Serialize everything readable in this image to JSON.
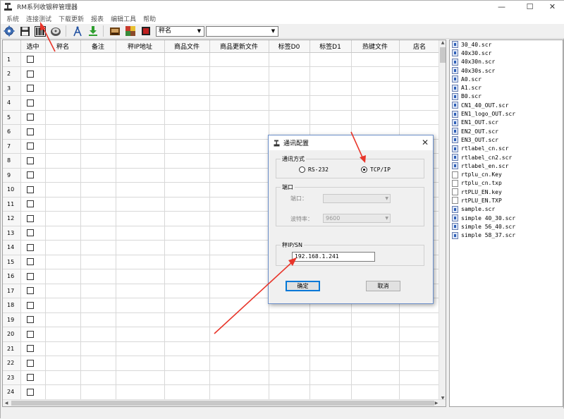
{
  "window": {
    "title": "RM系列收银秤管理器",
    "controls": [
      "—",
      "☐",
      "✕"
    ]
  },
  "menu": [
    "系统",
    "连接测试",
    "下载更新",
    "报表",
    "编辑工具",
    "帮助"
  ],
  "toolbar": {
    "field_select": "秤名",
    "search_value": ""
  },
  "grid": {
    "columns": [
      "选中",
      "秤名",
      "备注",
      "秤IP地址",
      "商品文件",
      "商品更新文件",
      "标签D0",
      "标签D1",
      "热键文件",
      "店名"
    ],
    "rows": [
      "1",
      "2",
      "3",
      "4",
      "5",
      "6",
      "7",
      "8",
      "9",
      "10",
      "11",
      "12",
      "13",
      "14",
      "15",
      "16",
      "17",
      "18",
      "19",
      "20",
      "21",
      "22",
      "23",
      "24"
    ]
  },
  "files": [
    {
      "name": "30_40.scr",
      "kind": "scr"
    },
    {
      "name": "40x30.scr",
      "kind": "scr"
    },
    {
      "name": "40x30n.scr",
      "kind": "scr"
    },
    {
      "name": "40x30s.scr",
      "kind": "scr"
    },
    {
      "name": "A0.scr",
      "kind": "scr"
    },
    {
      "name": "A1.scr",
      "kind": "scr"
    },
    {
      "name": "B0.scr",
      "kind": "scr"
    },
    {
      "name": "CN1_40_OUT.scr",
      "kind": "scr"
    },
    {
      "name": "EN1_logo_OUT.scr",
      "kind": "scr"
    },
    {
      "name": "EN1_OUT.scr",
      "kind": "scr"
    },
    {
      "name": "EN2_OUT.scr",
      "kind": "scr"
    },
    {
      "name": "EN3_OUT.scr",
      "kind": "scr"
    },
    {
      "name": "rtlabel_cn.scr",
      "kind": "scr"
    },
    {
      "name": "rtlabel_cn2.scr",
      "kind": "scr"
    },
    {
      "name": "rtlabel_en.scr",
      "kind": "scr"
    },
    {
      "name": "rtplu_cn.Key",
      "kind": "doc"
    },
    {
      "name": "rtplu_cn.txp",
      "kind": "doc"
    },
    {
      "name": "rtPLU_EN.key",
      "kind": "doc"
    },
    {
      "name": "rtPLU_EN.TXP",
      "kind": "doc"
    },
    {
      "name": "sample.scr",
      "kind": "scr"
    },
    {
      "name": "simple 40_30.scr",
      "kind": "scr"
    },
    {
      "name": "simple 56_40.scr",
      "kind": "scr"
    },
    {
      "name": "simple 58_37.scr",
      "kind": "scr"
    }
  ],
  "dialog": {
    "title": "通讯配置",
    "comm_group": "通讯方式",
    "radio_rs232": "RS-232",
    "radio_tcpip": "TCP/IP",
    "port_group": "端口",
    "port_label": "端口：",
    "port_value": "",
    "baud_label": "波特率：",
    "baud_value": "9600",
    "ip_group": "秤IP/SN",
    "ip_value": "192.168.1.241",
    "ok_label": "确定",
    "cancel_label": "取消"
  },
  "colors": {
    "annotation_arrow": "#e8352a",
    "dialog_border": "#6b8fc9",
    "default_button": "#0078d7"
  }
}
